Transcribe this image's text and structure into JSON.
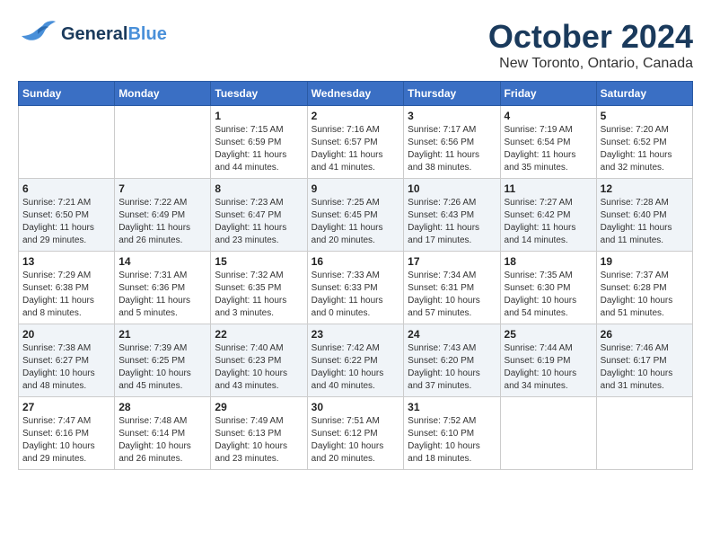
{
  "header": {
    "logo_line1": "General",
    "logo_line2": "Blue",
    "month_title": "October 2024",
    "location": "New Toronto, Ontario, Canada"
  },
  "days_of_week": [
    "Sunday",
    "Monday",
    "Tuesday",
    "Wednesday",
    "Thursday",
    "Friday",
    "Saturday"
  ],
  "weeks": [
    [
      {
        "day": "",
        "sunrise": "",
        "sunset": "",
        "daylight": ""
      },
      {
        "day": "",
        "sunrise": "",
        "sunset": "",
        "daylight": ""
      },
      {
        "day": "1",
        "sunrise": "Sunrise: 7:15 AM",
        "sunset": "Sunset: 6:59 PM",
        "daylight": "Daylight: 11 hours and 44 minutes."
      },
      {
        "day": "2",
        "sunrise": "Sunrise: 7:16 AM",
        "sunset": "Sunset: 6:57 PM",
        "daylight": "Daylight: 11 hours and 41 minutes."
      },
      {
        "day": "3",
        "sunrise": "Sunrise: 7:17 AM",
        "sunset": "Sunset: 6:56 PM",
        "daylight": "Daylight: 11 hours and 38 minutes."
      },
      {
        "day": "4",
        "sunrise": "Sunrise: 7:19 AM",
        "sunset": "Sunset: 6:54 PM",
        "daylight": "Daylight: 11 hours and 35 minutes."
      },
      {
        "day": "5",
        "sunrise": "Sunrise: 7:20 AM",
        "sunset": "Sunset: 6:52 PM",
        "daylight": "Daylight: 11 hours and 32 minutes."
      }
    ],
    [
      {
        "day": "6",
        "sunrise": "Sunrise: 7:21 AM",
        "sunset": "Sunset: 6:50 PM",
        "daylight": "Daylight: 11 hours and 29 minutes."
      },
      {
        "day": "7",
        "sunrise": "Sunrise: 7:22 AM",
        "sunset": "Sunset: 6:49 PM",
        "daylight": "Daylight: 11 hours and 26 minutes."
      },
      {
        "day": "8",
        "sunrise": "Sunrise: 7:23 AM",
        "sunset": "Sunset: 6:47 PM",
        "daylight": "Daylight: 11 hours and 23 minutes."
      },
      {
        "day": "9",
        "sunrise": "Sunrise: 7:25 AM",
        "sunset": "Sunset: 6:45 PM",
        "daylight": "Daylight: 11 hours and 20 minutes."
      },
      {
        "day": "10",
        "sunrise": "Sunrise: 7:26 AM",
        "sunset": "Sunset: 6:43 PM",
        "daylight": "Daylight: 11 hours and 17 minutes."
      },
      {
        "day": "11",
        "sunrise": "Sunrise: 7:27 AM",
        "sunset": "Sunset: 6:42 PM",
        "daylight": "Daylight: 11 hours and 14 minutes."
      },
      {
        "day": "12",
        "sunrise": "Sunrise: 7:28 AM",
        "sunset": "Sunset: 6:40 PM",
        "daylight": "Daylight: 11 hours and 11 minutes."
      }
    ],
    [
      {
        "day": "13",
        "sunrise": "Sunrise: 7:29 AM",
        "sunset": "Sunset: 6:38 PM",
        "daylight": "Daylight: 11 hours and 8 minutes."
      },
      {
        "day": "14",
        "sunrise": "Sunrise: 7:31 AM",
        "sunset": "Sunset: 6:36 PM",
        "daylight": "Daylight: 11 hours and 5 minutes."
      },
      {
        "day": "15",
        "sunrise": "Sunrise: 7:32 AM",
        "sunset": "Sunset: 6:35 PM",
        "daylight": "Daylight: 11 hours and 3 minutes."
      },
      {
        "day": "16",
        "sunrise": "Sunrise: 7:33 AM",
        "sunset": "Sunset: 6:33 PM",
        "daylight": "Daylight: 11 hours and 0 minutes."
      },
      {
        "day": "17",
        "sunrise": "Sunrise: 7:34 AM",
        "sunset": "Sunset: 6:31 PM",
        "daylight": "Daylight: 10 hours and 57 minutes."
      },
      {
        "day": "18",
        "sunrise": "Sunrise: 7:35 AM",
        "sunset": "Sunset: 6:30 PM",
        "daylight": "Daylight: 10 hours and 54 minutes."
      },
      {
        "day": "19",
        "sunrise": "Sunrise: 7:37 AM",
        "sunset": "Sunset: 6:28 PM",
        "daylight": "Daylight: 10 hours and 51 minutes."
      }
    ],
    [
      {
        "day": "20",
        "sunrise": "Sunrise: 7:38 AM",
        "sunset": "Sunset: 6:27 PM",
        "daylight": "Daylight: 10 hours and 48 minutes."
      },
      {
        "day": "21",
        "sunrise": "Sunrise: 7:39 AM",
        "sunset": "Sunset: 6:25 PM",
        "daylight": "Daylight: 10 hours and 45 minutes."
      },
      {
        "day": "22",
        "sunrise": "Sunrise: 7:40 AM",
        "sunset": "Sunset: 6:23 PM",
        "daylight": "Daylight: 10 hours and 43 minutes."
      },
      {
        "day": "23",
        "sunrise": "Sunrise: 7:42 AM",
        "sunset": "Sunset: 6:22 PM",
        "daylight": "Daylight: 10 hours and 40 minutes."
      },
      {
        "day": "24",
        "sunrise": "Sunrise: 7:43 AM",
        "sunset": "Sunset: 6:20 PM",
        "daylight": "Daylight: 10 hours and 37 minutes."
      },
      {
        "day": "25",
        "sunrise": "Sunrise: 7:44 AM",
        "sunset": "Sunset: 6:19 PM",
        "daylight": "Daylight: 10 hours and 34 minutes."
      },
      {
        "day": "26",
        "sunrise": "Sunrise: 7:46 AM",
        "sunset": "Sunset: 6:17 PM",
        "daylight": "Daylight: 10 hours and 31 minutes."
      }
    ],
    [
      {
        "day": "27",
        "sunrise": "Sunrise: 7:47 AM",
        "sunset": "Sunset: 6:16 PM",
        "daylight": "Daylight: 10 hours and 29 minutes."
      },
      {
        "day": "28",
        "sunrise": "Sunrise: 7:48 AM",
        "sunset": "Sunset: 6:14 PM",
        "daylight": "Daylight: 10 hours and 26 minutes."
      },
      {
        "day": "29",
        "sunrise": "Sunrise: 7:49 AM",
        "sunset": "Sunset: 6:13 PM",
        "daylight": "Daylight: 10 hours and 23 minutes."
      },
      {
        "day": "30",
        "sunrise": "Sunrise: 7:51 AM",
        "sunset": "Sunset: 6:12 PM",
        "daylight": "Daylight: 10 hours and 20 minutes."
      },
      {
        "day": "31",
        "sunrise": "Sunrise: 7:52 AM",
        "sunset": "Sunset: 6:10 PM",
        "daylight": "Daylight: 10 hours and 18 minutes."
      },
      {
        "day": "",
        "sunrise": "",
        "sunset": "",
        "daylight": ""
      },
      {
        "day": "",
        "sunrise": "",
        "sunset": "",
        "daylight": ""
      }
    ]
  ]
}
